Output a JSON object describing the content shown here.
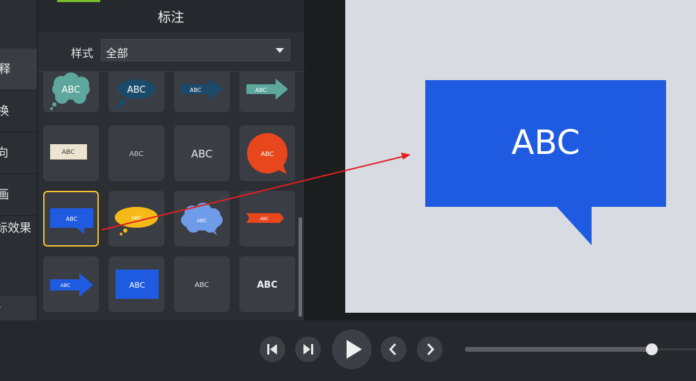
{
  "sidebar": {
    "items": [
      {
        "label": "释"
      },
      {
        "label": "换"
      },
      {
        "label": "向"
      },
      {
        "label": "画"
      },
      {
        "label": "标效果"
      }
    ],
    "bottom_label": "."
  },
  "panel": {
    "title": "标注",
    "style_label": "样式",
    "style_value": "全部",
    "tiles": [
      {
        "name": "thought-cloud-teal",
        "text": "ABC"
      },
      {
        "name": "thought-oval-navy",
        "text": "ABC"
      },
      {
        "name": "arrow-navy",
        "text": "ABC"
      },
      {
        "name": "arrow-teal",
        "text": "ABC"
      },
      {
        "name": "label-beige",
        "text": "ABC"
      },
      {
        "name": "text-small",
        "text": "ABC"
      },
      {
        "name": "text-medium",
        "text": "ABC"
      },
      {
        "name": "speech-circle-orange",
        "text": "ABC"
      },
      {
        "name": "speech-rect-blue",
        "text": "ABC",
        "selected": true
      },
      {
        "name": "thought-oval-yellow",
        "text": "ABC"
      },
      {
        "name": "thought-cloud-blue",
        "text": "ABC"
      },
      {
        "name": "ribbon-orange",
        "text": "ABC"
      },
      {
        "name": "arrow-blue",
        "text": "ABC"
      },
      {
        "name": "rect-blue",
        "text": "ABC"
      },
      {
        "name": "text-plain",
        "text": "ABC"
      },
      {
        "name": "text-bold",
        "text": "ABC"
      }
    ]
  },
  "preview": {
    "callout_text": "ABC",
    "callout_color": "#1f5be0"
  },
  "playback": {
    "buttons": [
      "step-back",
      "step-forward",
      "play",
      "previous",
      "next"
    ],
    "progress": 0.96
  },
  "colors": {
    "selection": "#f2c230",
    "annotation_arrow": "#e02020"
  }
}
